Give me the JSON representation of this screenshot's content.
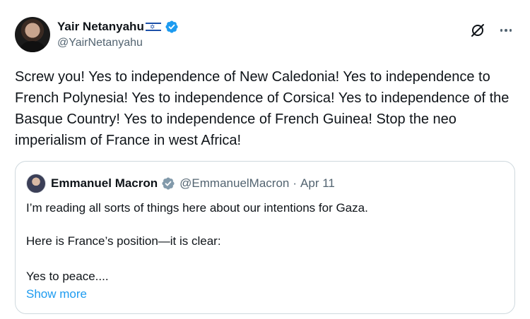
{
  "author": {
    "display_name": "Yair Netanyahu",
    "handle": "@YairNetanyahu",
    "flag": "israel-flag-icon",
    "verified_color": "#1d9bf0"
  },
  "tweet": {
    "text": "Screw you! Yes to independence of New Caledonia! Yes to independence to French Polynesia! Yes to independence of Corsica! Yes to independence of the Basque Country! Yes to independence of French Guinea! Stop the neo imperialism of France in west Africa!"
  },
  "quoted": {
    "display_name": "Emmanuel Macron",
    "handle": "@EmmanuelMacron",
    "separator": "·",
    "date": "Apr 11",
    "verified_color": "#829aab",
    "lines": [
      "I’m reading all sorts of things here about our intentions for Gaza.",
      "Here is France’s position—it is clear:",
      "Yes to peace...."
    ],
    "show_more": "Show more"
  },
  "colors": {
    "text": "#0f1419",
    "secondary": "#536471",
    "link": "#1d9bf0",
    "border": "#cfd9de"
  }
}
